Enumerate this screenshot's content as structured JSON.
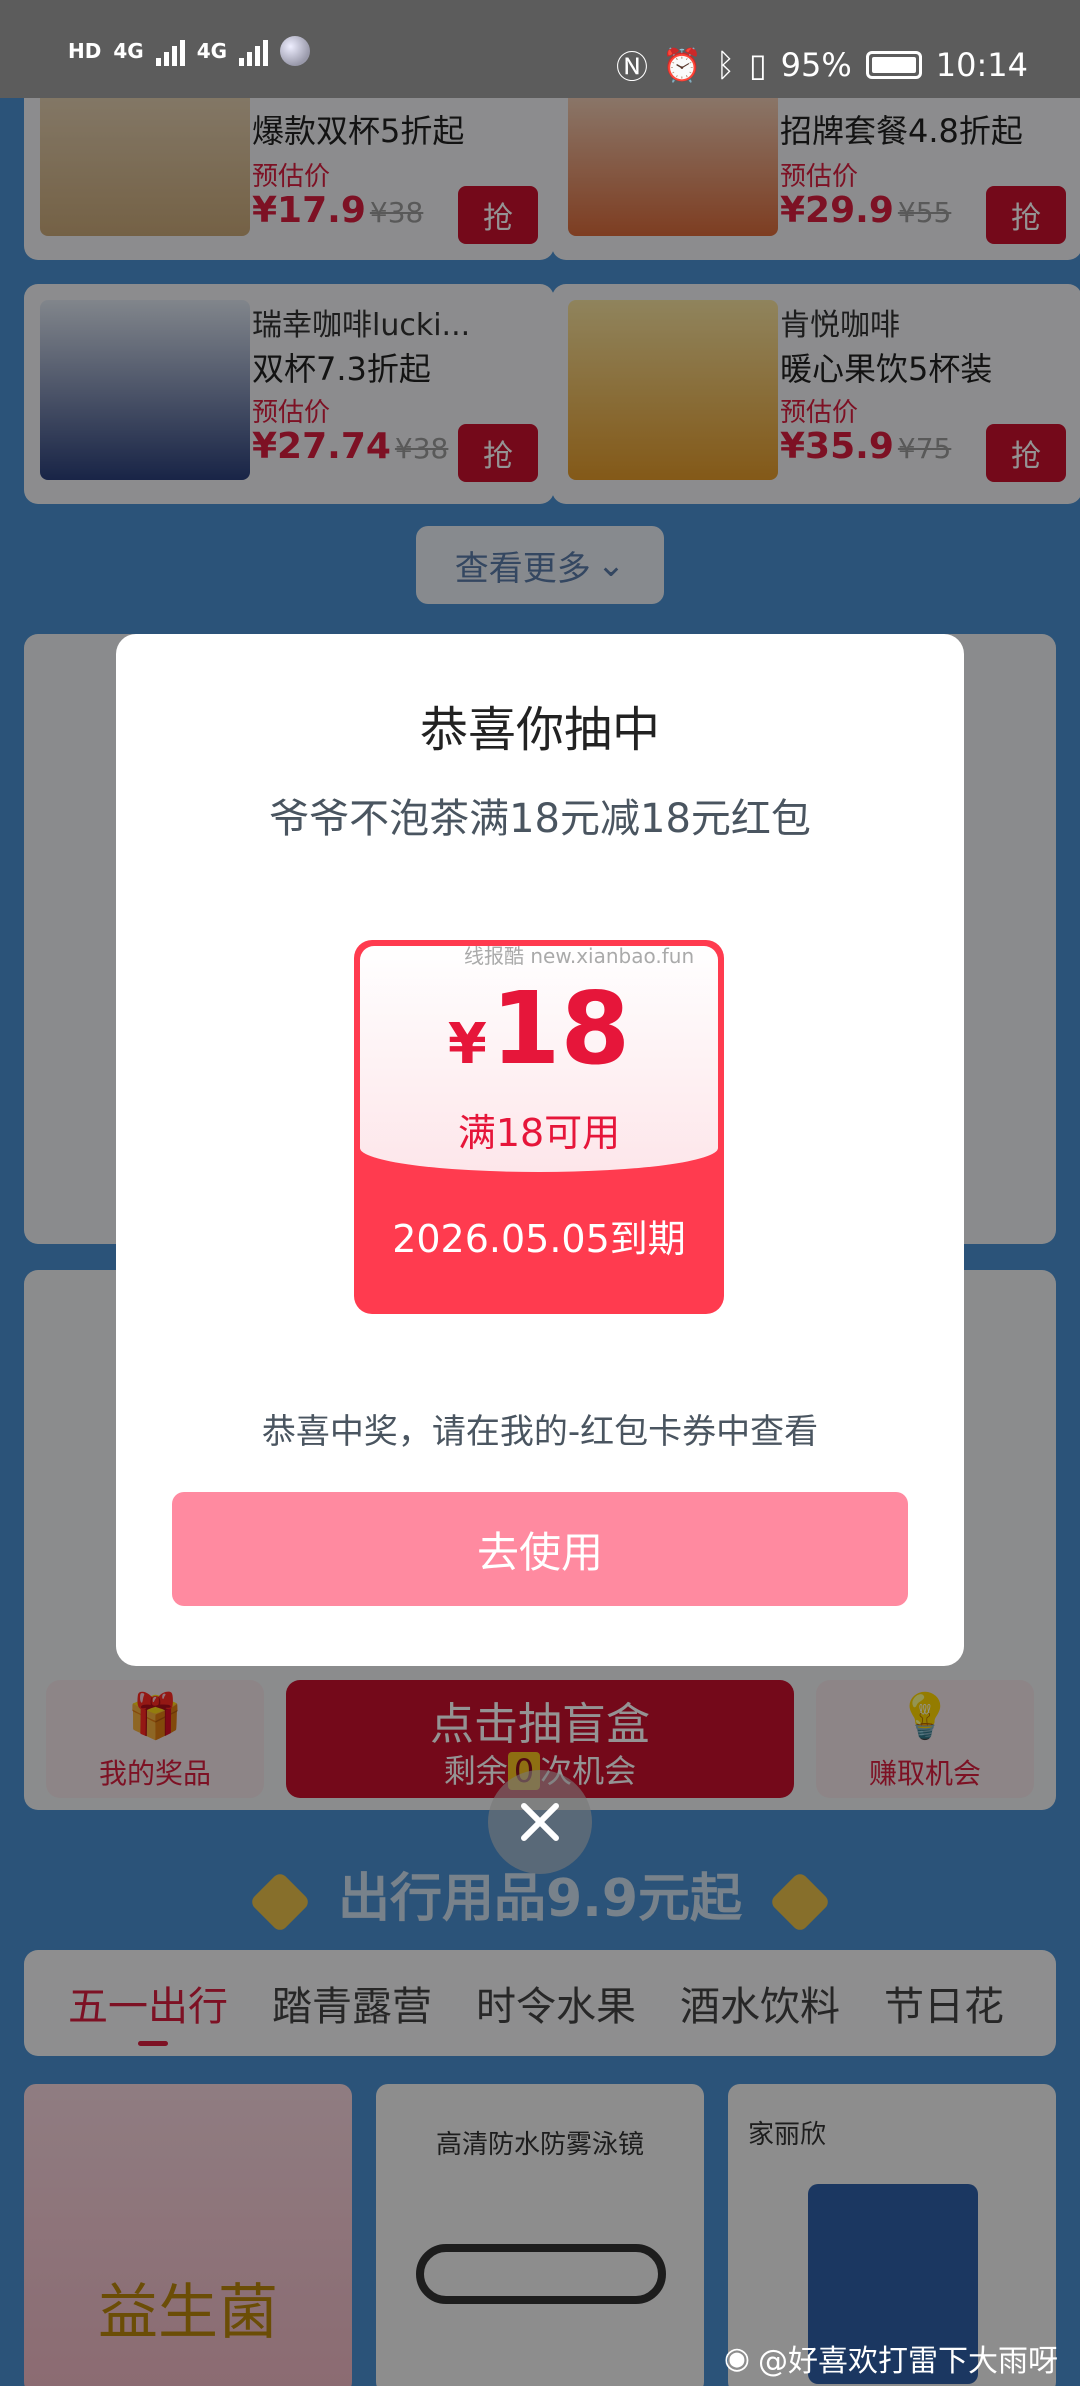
{
  "status_bar": {
    "hd1": "HD",
    "hd2": "HD",
    "net1": "4G",
    "net2": "4G",
    "battery": "95%",
    "time": "10:14"
  },
  "products": [
    {
      "shop": "",
      "title": "爆款双杯5折起",
      "est": "预估价",
      "price": "¥17.9",
      "old": "¥38",
      "btn": "抢"
    },
    {
      "shop": "",
      "title": "招牌套餐4.8折起",
      "est": "预估价",
      "price": "¥29.9",
      "old": "¥55",
      "btn": "抢"
    },
    {
      "shop": "瑞幸咖啡lucki...",
      "title": "双杯7.3折起",
      "est": "预估价",
      "price": "¥27.74",
      "old": "¥38",
      "btn": "抢"
    },
    {
      "shop": "肯悦咖啡",
      "title": "暖心果饮5杯装",
      "est": "预估价",
      "price": "¥35.9",
      "old": "¥75",
      "btn": "抢"
    }
  ],
  "view_more": "查看更多",
  "blind_box": {
    "my_prizes": "我的奖品",
    "draw_title": "点击抽盲盒",
    "draw_prefix": "剩余",
    "draw_count": "0",
    "draw_suffix": "次机会",
    "earn": "赚取机会"
  },
  "section_title": "出行用品9.9元起",
  "tabs": [
    "五一出行",
    "踏青露营",
    "时令水果",
    "酒水饮料",
    "节日花"
  ],
  "bottom_products": [
    "益生菌",
    "高清防水防雾泳镜",
    "家丽欣"
  ],
  "modal": {
    "title": "恭喜你抽中",
    "subtitle": "爷爷不泡茶满18元减18元红包",
    "coupon_watermark": "线报酷 new.xianbao.fun",
    "currency": "¥",
    "amount": "18",
    "condition": "满18可用",
    "expiry": "2026.05.05到期",
    "note": "恭喜中奖，请在我的-红包卡券中查看",
    "use_button": "去使用"
  },
  "watermark": "@好喜欢打雷下大雨呀",
  "colors": {
    "accent": "#d81e3e",
    "use_button": "#ff8aa0",
    "coupon": "#ff3b4f",
    "page_bg": "#4a90d0"
  }
}
